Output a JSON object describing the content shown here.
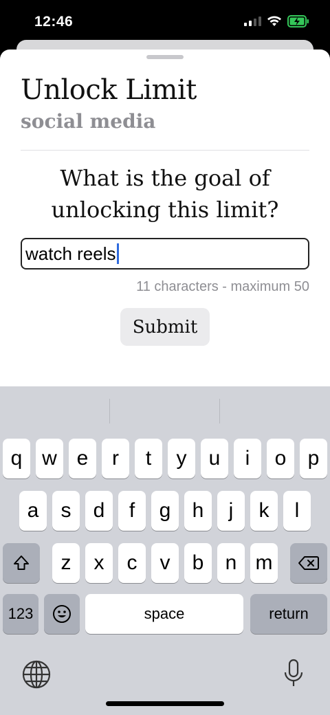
{
  "status": {
    "time": "12:46"
  },
  "sheet": {
    "title": "Unlock Limit",
    "subtitle": "social media",
    "question": "What is the goal of unlocking this limit?",
    "input_value": "watch reels",
    "char_count": "11 characters - maximum 50",
    "submit_label": "Submit"
  },
  "keyboard": {
    "row1": [
      "q",
      "w",
      "e",
      "r",
      "t",
      "y",
      "u",
      "i",
      "o",
      "p"
    ],
    "row2": [
      "a",
      "s",
      "d",
      "f",
      "g",
      "h",
      "j",
      "k",
      "l"
    ],
    "row3": [
      "z",
      "x",
      "c",
      "v",
      "b",
      "n",
      "m"
    ],
    "numbers_label": "123",
    "space_label": "space",
    "return_label": "return"
  },
  "colors": {
    "accent_caret": "#2f6bde",
    "battery": "#34c759"
  },
  "icons": [
    "signal-icon",
    "wifi-icon",
    "battery-icon",
    "shift-icon",
    "delete-icon",
    "emoji-icon",
    "globe-icon",
    "microphone-icon"
  ]
}
